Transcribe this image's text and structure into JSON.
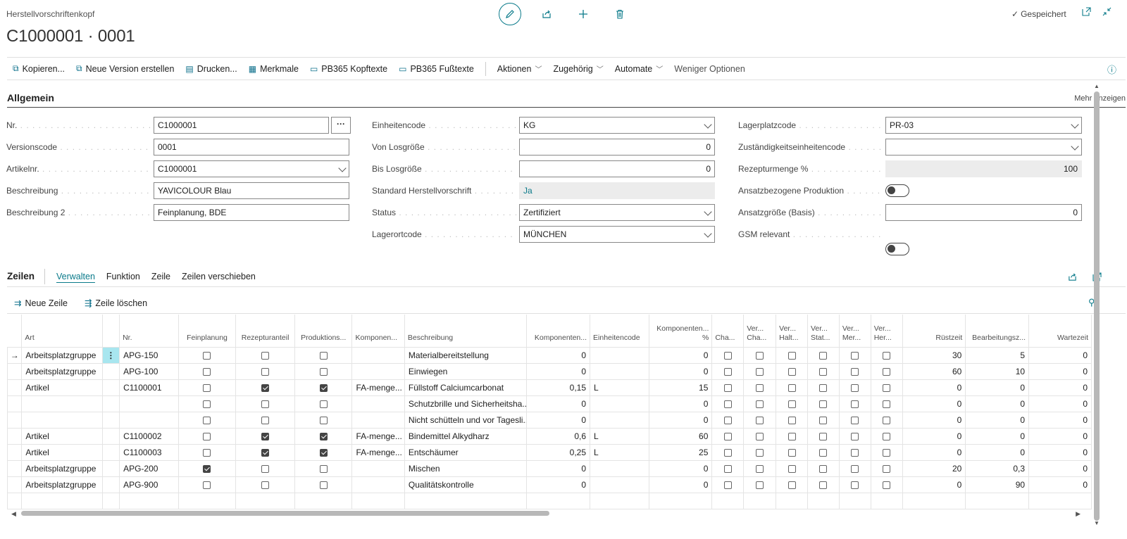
{
  "header": {
    "caption": "Herstellvorschriftenkopf",
    "title": "C1000001 · 0001",
    "saved": "Gespeichert"
  },
  "actions": [
    {
      "label": "Kopieren...",
      "icon": "copy-icon"
    },
    {
      "label": "Neue Version erstellen",
      "icon": "new-version-icon"
    },
    {
      "label": "Drucken...",
      "icon": "print-icon"
    },
    {
      "label": "Merkmale",
      "icon": "characteristics-icon"
    },
    {
      "label": "PB365 Kopftexte",
      "icon": "header-text-icon"
    },
    {
      "label": "PB365 Fußtexte",
      "icon": "footer-text-icon"
    }
  ],
  "menus": [
    "Aktionen",
    "Zugehörig",
    "Automate"
  ],
  "fewer_options": "Weniger Optionen",
  "general": {
    "title": "Allgemein",
    "more": "Mehr anzeigen",
    "col1": [
      {
        "label": "Nr.",
        "value": "C1000001"
      },
      {
        "label": "Versionscode",
        "value": "0001"
      },
      {
        "label": "Artikelnr.",
        "value": "C1000001"
      },
      {
        "label": "Beschreibung",
        "value": "YAVICOLOUR Blau"
      },
      {
        "label": "Beschreibung 2",
        "value": "Feinplanung, BDE"
      }
    ],
    "col2": [
      {
        "label": "Einheitencode",
        "value": "KG"
      },
      {
        "label": "Von Losgröße",
        "value": "0"
      },
      {
        "label": "Bis Losgröße",
        "value": "0"
      },
      {
        "label": "Standard Herstellvorschrift",
        "value": "Ja"
      },
      {
        "label": "Status",
        "value": "Zertifiziert"
      },
      {
        "label": "Lagerortcode",
        "value": "MÜNCHEN"
      }
    ],
    "col3": [
      {
        "label": "Lagerplatzcode",
        "value": "PR-03"
      },
      {
        "label": "Zuständigkeitseinheitencode",
        "value": ""
      },
      {
        "label": "Rezepturmenge %",
        "value": "100"
      },
      {
        "label": "Ansatzbezogene Produktion",
        "value": "off"
      },
      {
        "label": "Ansatzgröße (Basis)",
        "value": "0"
      },
      {
        "label": "GSM relevant",
        "value": "off"
      }
    ]
  },
  "lines": {
    "title": "Zeilen",
    "tabs": [
      "Verwalten",
      "Funktion",
      "Zeile",
      "Zeilen verschieben"
    ],
    "new_line": "Neue Zeile",
    "delete_line": "Zeile löschen",
    "columns": [
      "Art",
      "Nr.",
      "Feinplanung",
      "Rezepturanteil",
      "Produktions...",
      "Komponen...",
      "Beschreibung",
      "Komponenten...",
      "Einheitencode",
      "Komponenten... %",
      "Cha...",
      "Ver... Cha...",
      "Ver... Halt...",
      "Ver... Stat...",
      "Ver... Mer...",
      "Ver... Her...",
      "Rüstzeit",
      "Bearbeitungsz...",
      "Wartezeit"
    ],
    "rows": [
      {
        "art": "Arbeitsplatzgruppe",
        "nr": "APG-150",
        "fein": false,
        "rez": false,
        "prod": false,
        "komp": "",
        "beschr": "Materialbereitstellung",
        "menge": "0",
        "einheit": "",
        "proz": "0",
        "ruest": "30",
        "bearb": "5",
        "warte": "0"
      },
      {
        "art": "Arbeitsplatzgruppe",
        "nr": "APG-100",
        "fein": false,
        "rez": false,
        "prod": false,
        "komp": "",
        "beschr": "Einwiegen",
        "menge": "0",
        "einheit": "",
        "proz": "0",
        "ruest": "60",
        "bearb": "10",
        "warte": "0"
      },
      {
        "art": "Artikel",
        "nr": "C1100001",
        "fein": false,
        "rez": true,
        "prod": true,
        "komp": "FA-menge...",
        "beschr": "Füllstoff Calciumcarbonat",
        "menge": "0,15",
        "einheit": "L",
        "proz": "15",
        "ruest": "0",
        "bearb": "0",
        "warte": "0"
      },
      {
        "art": "",
        "nr": "",
        "fein": false,
        "rez": false,
        "prod": false,
        "komp": "",
        "beschr": "Schutzbrille und Sicherheitsha...",
        "menge": "0",
        "einheit": "",
        "proz": "0",
        "ruest": "0",
        "bearb": "0",
        "warte": "0"
      },
      {
        "art": "",
        "nr": "",
        "fein": false,
        "rez": false,
        "prod": false,
        "komp": "",
        "beschr": "Nicht schütteln und vor Tagesli...",
        "menge": "0",
        "einheit": "",
        "proz": "0",
        "ruest": "0",
        "bearb": "0",
        "warte": "0"
      },
      {
        "art": "Artikel",
        "nr": "C1100002",
        "fein": false,
        "rez": true,
        "prod": true,
        "komp": "FA-menge...",
        "beschr": "Bindemittel Alkydharz",
        "menge": "0,6",
        "einheit": "L",
        "proz": "60",
        "ruest": "0",
        "bearb": "0",
        "warte": "0"
      },
      {
        "art": "Artikel",
        "nr": "C1100003",
        "fein": false,
        "rez": true,
        "prod": true,
        "komp": "FA-menge...",
        "beschr": "Entschäumer",
        "menge": "0,25",
        "einheit": "L",
        "proz": "25",
        "ruest": "0",
        "bearb": "0",
        "warte": "0"
      },
      {
        "art": "Arbeitsplatzgruppe",
        "nr": "APG-200",
        "fein": true,
        "rez": false,
        "prod": false,
        "komp": "",
        "beschr": "Mischen",
        "menge": "0",
        "einheit": "",
        "proz": "0",
        "ruest": "20",
        "bearb": "0,3",
        "warte": "0"
      },
      {
        "art": "Arbeitsplatzgruppe",
        "nr": "APG-900",
        "fein": false,
        "rez": false,
        "prod": false,
        "komp": "",
        "beschr": "Qualitätskontrolle",
        "menge": "0",
        "einheit": "",
        "proz": "0",
        "ruest": "0",
        "bearb": "90",
        "warte": "0"
      }
    ]
  }
}
